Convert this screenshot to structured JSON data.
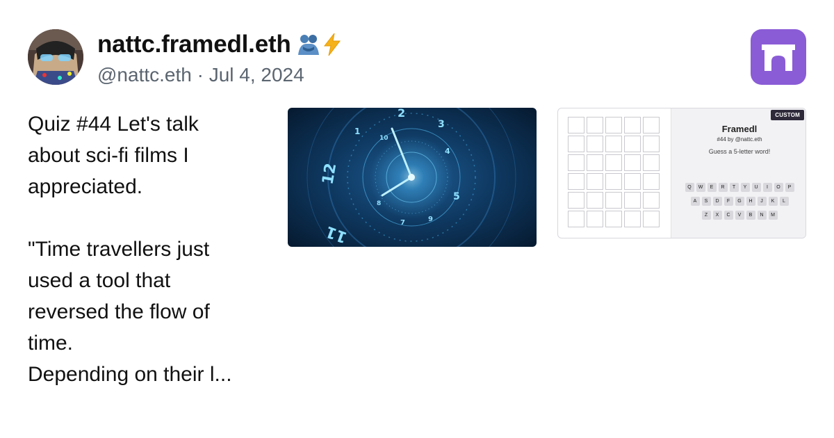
{
  "author": {
    "display_name": "nattc.framedl.eth",
    "handle_date": "@nattc.eth · Jul 4, 2024",
    "emoji": [
      "people-hugging-emoji",
      "lightning-emoji"
    ]
  },
  "post": {
    "text": "Quiz #44 Let's talk\nabout sci-fi films I\nappreciated.\n\n\"Time travellers just\nused a tool that\nreversed the flow of\ntime.\nDepending on their l..."
  },
  "embed_image": {
    "icon": "clock-vortex-image",
    "dial_numbers": [
      "2",
      "3",
      "12",
      "11",
      "10",
      "1",
      "9",
      "8",
      "7",
      "5",
      "4"
    ]
  },
  "frame": {
    "badge": "CUSTOM",
    "title": "Framedl",
    "subtitle": "#44 by @nattc.eth",
    "prompt": "Guess a 5-letter word!",
    "keyboard_rows": [
      [
        "Q",
        "W",
        "E",
        "R",
        "T",
        "Y",
        "U",
        "I",
        "O",
        "P"
      ],
      [
        "A",
        "S",
        "D",
        "F",
        "G",
        "H",
        "J",
        "K",
        "L"
      ],
      [
        "Z",
        "X",
        "C",
        "V",
        "B",
        "N",
        "M"
      ]
    ]
  },
  "colors": {
    "app_logo": "#8a5cd6",
    "meta_text": "#5b6570",
    "clock_glow": "#4fc3ff"
  }
}
